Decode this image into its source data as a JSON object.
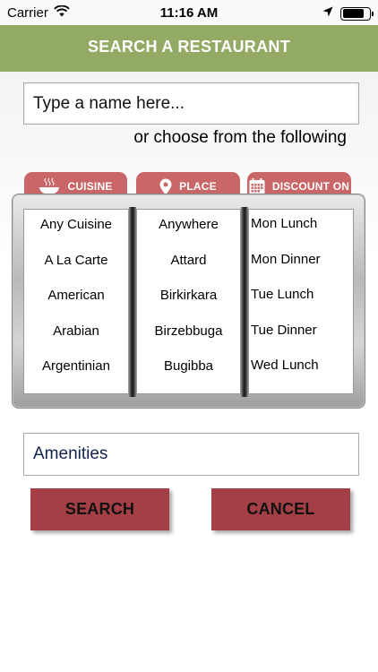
{
  "status_bar": {
    "carrier": "Carrier",
    "time": "11:16 AM"
  },
  "header": {
    "title": "SEARCH A RESTAURANT",
    "color": "#92aa64"
  },
  "search": {
    "placeholder": "Type a name here..."
  },
  "choose_text": "or choose from the following",
  "tabs": {
    "cuisine": "CUISINE",
    "place": "PLACE",
    "discount": "DISCOUNT ON",
    "color": "#c96668"
  },
  "pickers": {
    "cuisine": [
      "Any Cuisine",
      "A La Carte",
      "American",
      "Arabian",
      "Argentinian"
    ],
    "place": [
      "Anywhere",
      "Attard",
      "Birkirkara",
      "Birzebbuga",
      "Bugibba"
    ],
    "discount": [
      "Mon Lunch",
      "Mon Dinner",
      "Tue Lunch",
      "Tue Dinner",
      "Wed Lunch"
    ]
  },
  "amenities": {
    "label": "Amenities"
  },
  "buttons": {
    "search": "SEARCH",
    "cancel": "CANCEL",
    "color": "#a43f46"
  },
  "icons": {
    "wifi": "wifi-icon",
    "location_arrow": "location-arrow-icon",
    "battery": "battery-icon",
    "cuisine": "soup-bowl-icon",
    "place": "map-pin-icon",
    "discount": "calendar-icon"
  }
}
